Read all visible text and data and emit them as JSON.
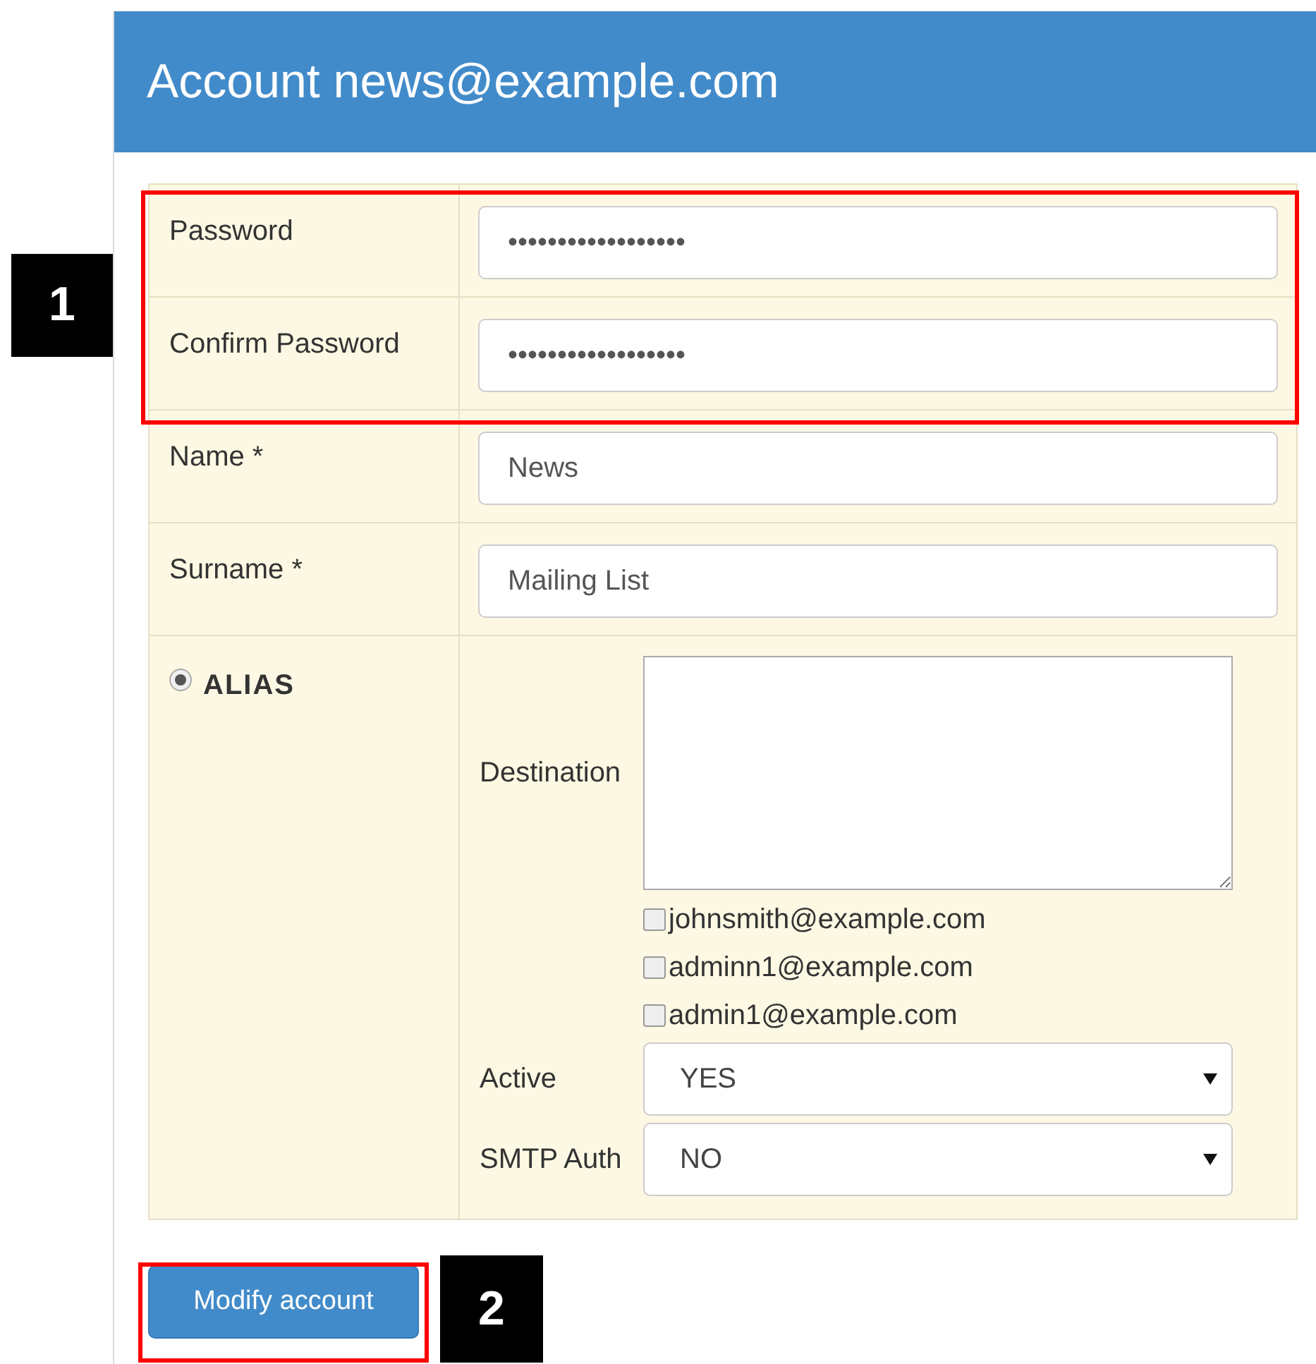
{
  "header": {
    "title": "Account news@example.com"
  },
  "fields": [
    {
      "label": "Password",
      "value": "••••••••••••••••••"
    },
    {
      "label": "Confirm Password",
      "value": "••••••••••••••••••"
    },
    {
      "label": "Name *",
      "value": "News"
    },
    {
      "label": "Surname *",
      "value": "Mailing List"
    }
  ],
  "alias": {
    "label": "ALIAS",
    "selected": true,
    "destination_label": "Destination",
    "recipients": [
      {
        "email": "johnsmith@example.com",
        "checked": false
      },
      {
        "email": "adminn1@example.com",
        "checked": false
      },
      {
        "email": "admin1@example.com",
        "checked": false
      }
    ],
    "selects": [
      {
        "label": "Active",
        "value": "YES"
      },
      {
        "label": "SMTP Auth",
        "value": "NO"
      }
    ]
  },
  "button": "Modify account",
  "callouts": [
    {
      "number": "1"
    },
    {
      "number": "2"
    }
  ]
}
